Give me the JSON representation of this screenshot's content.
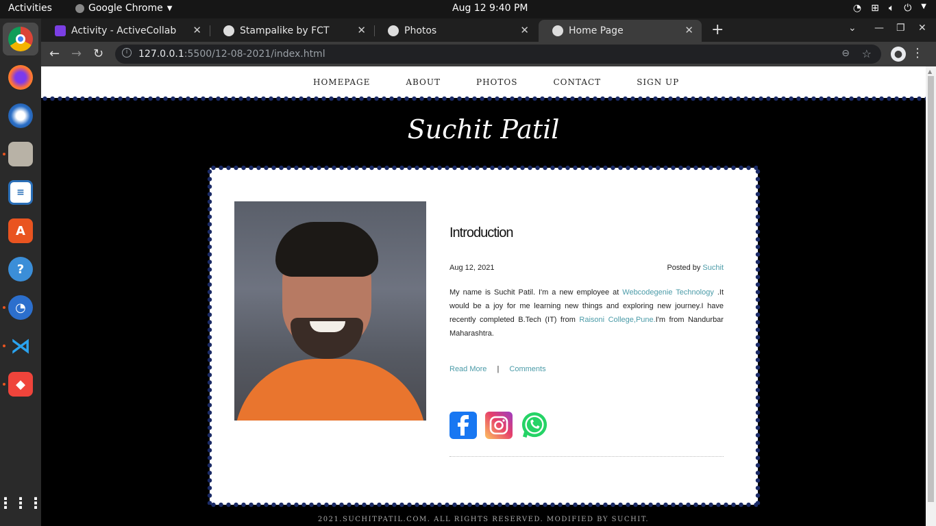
{
  "system": {
    "activities": "Activities",
    "app_name": "Google Chrome",
    "clock": "Aug 12  9:40 PM"
  },
  "dock": {
    "apps": [
      "chrome-icon",
      "firefox-icon",
      "thunderbird-icon",
      "files-icon",
      "writer-icon",
      "software-icon",
      "help-icon",
      "timer-icon",
      "vscode-icon",
      "anydesk-icon",
      "app-grid-icon"
    ]
  },
  "browser": {
    "tabs": [
      {
        "label": "Activity - ActiveCollab",
        "active": false
      },
      {
        "label": "Stampalike by FCT",
        "active": false
      },
      {
        "label": "Photos",
        "active": false
      },
      {
        "label": "Home Page",
        "active": true
      }
    ],
    "url_host": "127.0.0.1",
    "url_rest": ":5500/12-08-2021/index.html"
  },
  "site": {
    "nav": [
      "HOMEPAGE",
      "ABOUT",
      "PHOTOS",
      "CONTACT",
      "SIGN UP"
    ],
    "title": "Suchit Patil",
    "post": {
      "heading": "Introduction",
      "date": "Aug 12, 2021",
      "posted_by_label": "Posted by",
      "author": "Suchit",
      "body_1": "My name is Suchit Patil. I'm a new employee at",
      "company": "Webcodegenie Technology",
      "body_2": ".It would be a joy for me learning new things and exploring new journey.I have recently completed B.Tech (IT) from",
      "college": "Raisoni College,Pune.",
      "body_3": "I'm from Nandurbar Maharashtra.",
      "read_more": "Read More",
      "separator": "|",
      "comments": "Comments"
    },
    "footer": "2021.SUCHITPATIL.COM. ALL RIGHTS RESERVED. MODIFIED BY SUCHIT."
  },
  "colors": {
    "link": "#4b9ba8",
    "stamp_dot": "#1a2a66",
    "facebook": "#1877f2",
    "whatsapp": "#25d366"
  }
}
